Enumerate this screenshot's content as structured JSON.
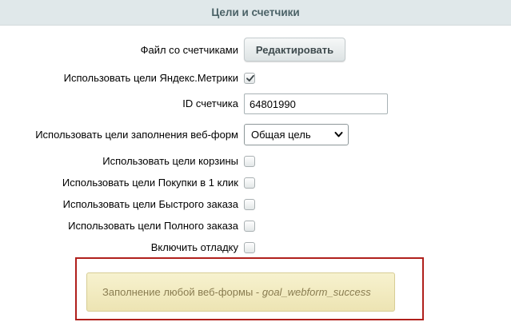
{
  "section": {
    "title": "Цели и счетчики"
  },
  "fields": {
    "counters_file": {
      "label": "Файл со счетчиками",
      "button_label": "Редактировать"
    },
    "use_yandex_goals": {
      "label": "Использовать цели Яндекс.Метрики",
      "checked": true
    },
    "counter_id": {
      "label": "ID счетчика",
      "value": "64801990"
    },
    "webform_goals": {
      "label": "Использовать цели заполнения веб-форм",
      "selected": "Общая цель"
    },
    "cart_goals": {
      "label": "Использовать цели корзины",
      "checked": false
    },
    "one_click_goals": {
      "label": "Использовать цели Покупки в 1 клик",
      "checked": false
    },
    "quick_order_goals": {
      "label": "Использовать цели Быстрого заказа",
      "checked": false
    },
    "full_order_goals": {
      "label": "Использовать цели Полного заказа",
      "checked": false
    },
    "debug": {
      "label": "Включить отладку",
      "checked": false
    }
  },
  "notice": {
    "text": "Заполнение любой веб-формы - ",
    "goal_code": "goal_webform_success"
  },
  "colors": {
    "header_bg": "#e0e8ea",
    "header_text": "#4b6267",
    "highlight_border": "#b0201c",
    "notice_bg": "#f4eec5",
    "notice_text": "#8a7d51"
  },
  "icons": {
    "checkbox_check": "check-icon",
    "select_arrow": "chevron-down-icon"
  }
}
